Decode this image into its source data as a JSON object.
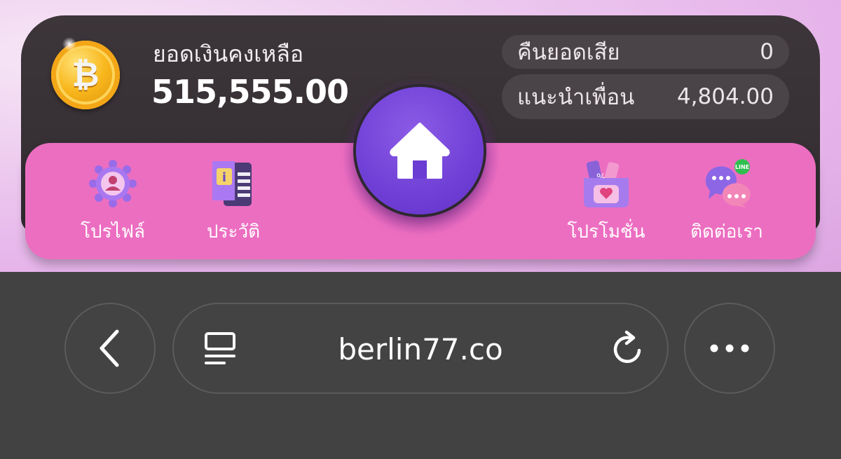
{
  "account": {
    "balance_label": "ยอดเงินคงเหลือ",
    "balance_amount": "515,555.00",
    "cashback_label": "คืนยอดเสีย",
    "cashback_value": "0",
    "referral_label": "แนะนำเพื่อน",
    "referral_value": "4,804.00"
  },
  "nav": {
    "items": [
      {
        "label": "โปรไฟล์",
        "icon": "profile-icon"
      },
      {
        "label": "ประวัติ",
        "icon": "history-icon"
      },
      {
        "label": "โปรโมชั่น",
        "icon": "promotion-icon"
      },
      {
        "label": "ติดต่อเรา",
        "icon": "contact-icon"
      }
    ],
    "home_icon": "home-icon"
  },
  "browser": {
    "url": "berlin77.co",
    "back_icon": "back-chevron-icon",
    "reader_icon": "reader-mode-icon",
    "reload_icon": "reload-icon",
    "more_icon": "more-icon"
  },
  "colors": {
    "card": "#3c3539",
    "nav": "#ec6ec1",
    "home": "#7040d6",
    "browser": "#424242"
  }
}
